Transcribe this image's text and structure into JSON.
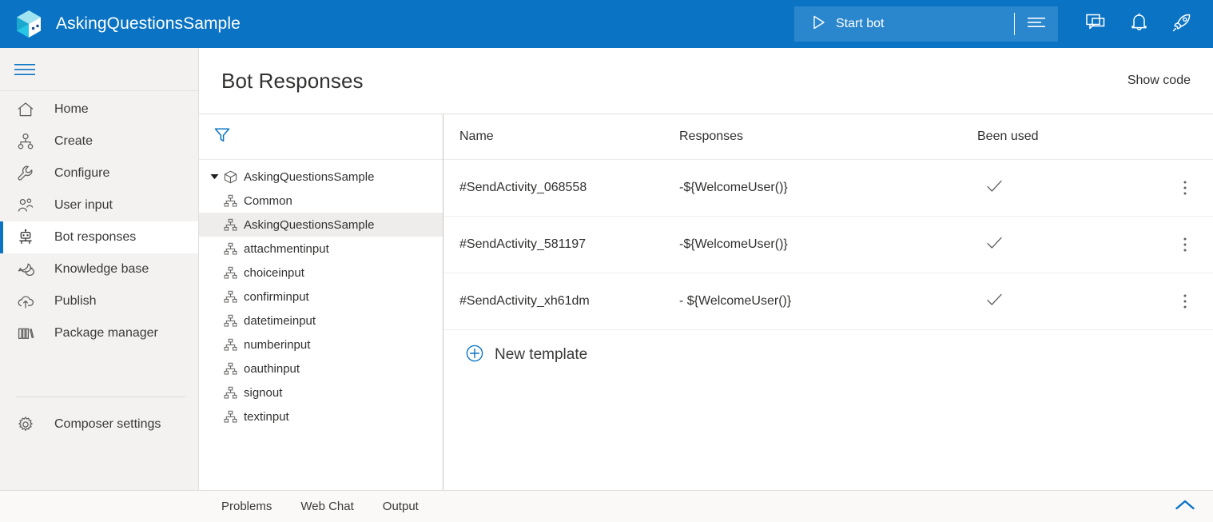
{
  "header": {
    "app_title": "AskingQuestionsSample",
    "logo_icon": "composer-cube-logo",
    "start_bot_label": "Start bot",
    "start_bot_icon": "play-icon",
    "start_bot_more_icon": "list-options-icon",
    "actions": [
      {
        "name": "web-chat-icon",
        "glyph": "chat-bubble-icon"
      },
      {
        "name": "notifications-icon",
        "glyph": "bell-icon"
      },
      {
        "name": "whats-new-icon",
        "glyph": "rocket-icon"
      }
    ],
    "accent_color": "#0a73c4",
    "start_bot_bg": "#2a86cd"
  },
  "sidebar": {
    "toggle_icon": "hamburger-menu-icon",
    "items": [
      {
        "label": "Home",
        "icon": "home-icon",
        "selected": false
      },
      {
        "label": "Create",
        "icon": "create-flow-icon",
        "selected": false
      },
      {
        "label": "Configure",
        "icon": "wrench-icon",
        "selected": false
      },
      {
        "label": "User input",
        "icon": "user-input-icon",
        "selected": false
      },
      {
        "label": "Bot responses",
        "icon": "robot-icon",
        "selected": true
      },
      {
        "label": "Knowledge base",
        "icon": "knowledge-chat-icon",
        "selected": false
      },
      {
        "label": "Publish",
        "icon": "cloud-upload-icon",
        "selected": false
      },
      {
        "label": "Package manager",
        "icon": "books-icon",
        "selected": false
      }
    ],
    "bottom_items": [
      {
        "label": "Composer settings",
        "icon": "gear-icon",
        "selected": false
      }
    ]
  },
  "main": {
    "page_title": "Bot Responses",
    "show_code_label": "Show code"
  },
  "tree": {
    "filter_icon": "filter-funnel-icon",
    "root": {
      "label": "AskingQuestionsSample",
      "icon": "bot-project-cube-icon",
      "expanded": true,
      "caret_icon": "caret-down-icon"
    },
    "children": [
      {
        "label": "Common",
        "icon": "dialog-tree-icon",
        "selected": false
      },
      {
        "label": "AskingQuestionsSample",
        "icon": "dialog-tree-icon",
        "selected": true
      },
      {
        "label": "attachmentinput",
        "icon": "dialog-tree-icon",
        "selected": false
      },
      {
        "label": "choiceinput",
        "icon": "dialog-tree-icon",
        "selected": false
      },
      {
        "label": "confirminput",
        "icon": "dialog-tree-icon",
        "selected": false
      },
      {
        "label": "datetimeinput",
        "icon": "dialog-tree-icon",
        "selected": false
      },
      {
        "label": "numberinput",
        "icon": "dialog-tree-icon",
        "selected": false
      },
      {
        "label": "oauthinput",
        "icon": "dialog-tree-icon",
        "selected": false
      },
      {
        "label": "signout",
        "icon": "dialog-tree-icon",
        "selected": false
      },
      {
        "label": "textinput",
        "icon": "dialog-tree-icon",
        "selected": false
      }
    ]
  },
  "table": {
    "columns": [
      "Name",
      "Responses",
      "Been used"
    ],
    "rows": [
      {
        "name": "#SendActivity_068558",
        "response": "-${WelcomeUser()}",
        "been_used": true,
        "used_icon": "checkmark-icon",
        "menu_icon": "more-vertical-icon"
      },
      {
        "name": "#SendActivity_581197",
        "response": "-${WelcomeUser()}",
        "been_used": true,
        "used_icon": "checkmark-icon",
        "menu_icon": "more-vertical-icon"
      },
      {
        "name": "#SendActivity_xh61dm",
        "response": "- ${WelcomeUser()}",
        "been_used": true,
        "used_icon": "checkmark-icon",
        "menu_icon": "more-vertical-icon"
      }
    ],
    "new_template_label": "New template",
    "new_template_icon": "circle-plus-icon"
  },
  "bottom_bar": {
    "tabs": [
      "Problems",
      "Web Chat",
      "Output"
    ],
    "collapse_icon": "chevron-up-icon",
    "collapse_icon_color": "#0a73c4"
  }
}
